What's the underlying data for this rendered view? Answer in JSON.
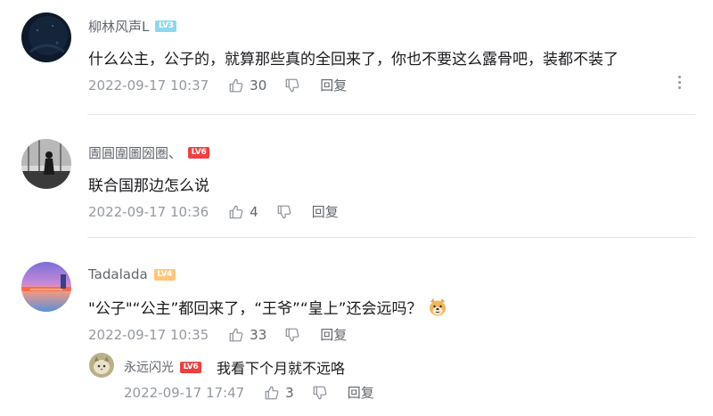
{
  "comments": [
    {
      "username": "柳林风声L",
      "level": "LV3",
      "text": "什么公主，公子的，就算那些真的全回来了，你也不要这么露骨吧，装都不装了",
      "time": "2022-09-17 10:37",
      "likes": "30",
      "reply_label": "回复",
      "avatar_icon": "dark-night-avatar"
    },
    {
      "username": "圊圓圍圖圀圏、",
      "level": "LV6",
      "text": "联合国那边怎么说",
      "time": "2022-09-17 10:36",
      "likes": "4",
      "reply_label": "回复",
      "avatar_icon": "silhouette-window-avatar"
    },
    {
      "username": "Tadalada",
      "level": "LV4",
      "text": "\"公子\"“公主”都回来了，“王爷”“皇上”还会远吗？",
      "emoji_icon": "doge-emoji",
      "time": "2022-09-17 10:35",
      "likes": "33",
      "reply_label": "回复",
      "avatar_icon": "sunset-lake-avatar",
      "replies": [
        {
          "username": "永远闪光",
          "level": "LV6",
          "text": "我看下个月就不远咯",
          "time": "2022-09-17 17:47",
          "likes": "3",
          "reply_label": "回复",
          "avatar_icon": "cat-avatar"
        }
      ]
    }
  ],
  "colors": {
    "username": "#61666d",
    "meta": "#9499a0",
    "text": "#18191c",
    "divider": "#e3e5e7",
    "lv3": "#8ed7f2",
    "lv4": "#ffc67a",
    "lv6": "#f23f3f"
  },
  "icons": [
    "thumb-up-icon",
    "thumb-down-icon",
    "more-vertical-icon"
  ]
}
